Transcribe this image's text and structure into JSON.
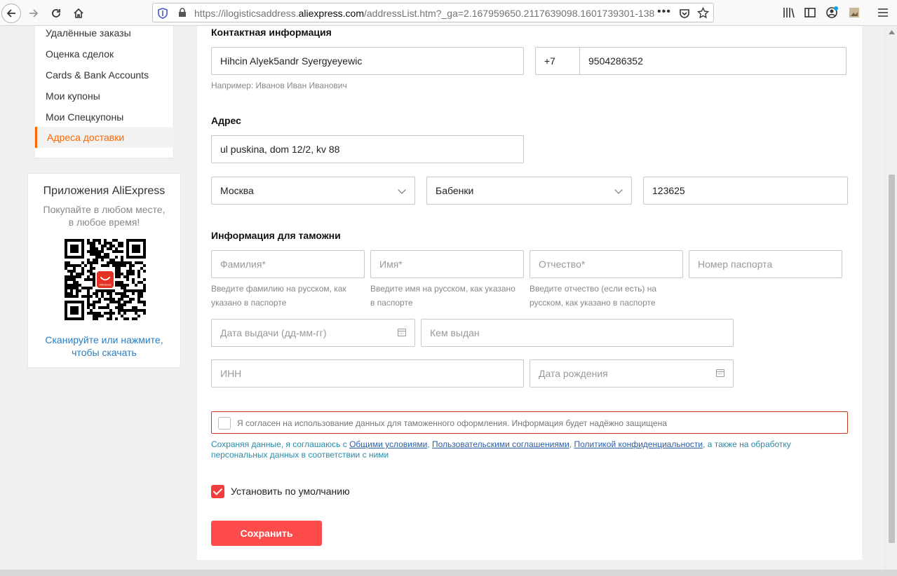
{
  "browser": {
    "url_prefix": "https://ilogisticsaddress.",
    "url_domain": "aliexpress.com",
    "url_suffix": "/addressList.htm?_ga=2.167959650.2117639098.1601739301-138"
  },
  "sidebar": {
    "items": [
      {
        "label": "Удалённые заказы"
      },
      {
        "label": "Оценка сделок"
      },
      {
        "label": "Cards & Bank Accounts"
      },
      {
        "label": "Мои купоны"
      },
      {
        "label": "Мои Спецкупоны"
      },
      {
        "label": "Адреса доставки",
        "active": true
      }
    ],
    "app": {
      "title": "Приложения AliExpress",
      "subtitle_line1": "Покупайте в любом месте,",
      "subtitle_line2": "в любое время!",
      "qr_logo_text": "AliExpress",
      "link_line1": "Сканируйте или нажмите,",
      "link_line2": "чтобы скачать"
    }
  },
  "form": {
    "contact": {
      "title": "Контактная информация",
      "name_value": "Hihcin Alyek5andr Syergyeyewic",
      "name_hint": "Например: Иванов Иван Иванович",
      "phone_code": "+7",
      "phone_value": "9504286352"
    },
    "address": {
      "title": "Адрес",
      "street_value": "ul puskina, dom 12/2, kv 88",
      "region_value": "Москва",
      "city_value": "Бабенки",
      "zip_value": "123625"
    },
    "customs": {
      "title": "Информация для таможни",
      "surname_placeholder": "Фамилия*",
      "firstname_placeholder": "Имя*",
      "patronymic_placeholder": "Отчество*",
      "passport_placeholder": "Номер паспорта",
      "surname_hint_1": "Введите фамилию на русском, как",
      "surname_hint_2": "указано в паспорте",
      "firstname_hint_1": "Введите имя на русском, как указано",
      "firstname_hint_2": "в паспорте",
      "patronymic_hint_1": "Введите отчество (если есть) на",
      "patronymic_hint_2": "русском, как указано в паспорте",
      "issue_date_placeholder": "Дата выдачи (дд-мм-гг)",
      "issued_by_placeholder": "Кем выдан",
      "inn_placeholder": "ИНН",
      "birth_date_placeholder": "Дата рождения"
    },
    "consent": {
      "text": "Я согласен на использование данных для таможенного оформления. Информация будет надёжно защищена",
      "checked": false
    },
    "legal": {
      "prefix": "Сохраняя данные, я соглашаюсь с ",
      "link1": "Общими условиями",
      "sep1": ", ",
      "link2": "Пользовательскими соглашениями",
      "sep2": ", ",
      "link3": "Политикой конфиденциальности",
      "suffix": ", а также на обработку персональных данных в соответствии с ними"
    },
    "default_label": "Установить по умолчанию",
    "default_checked": true,
    "save_label": "Сохранить"
  },
  "colors": {
    "accent": "#ff6600",
    "button": "#fd4b4b",
    "link": "#2a8ba8",
    "error_border": "#c83b1e"
  }
}
